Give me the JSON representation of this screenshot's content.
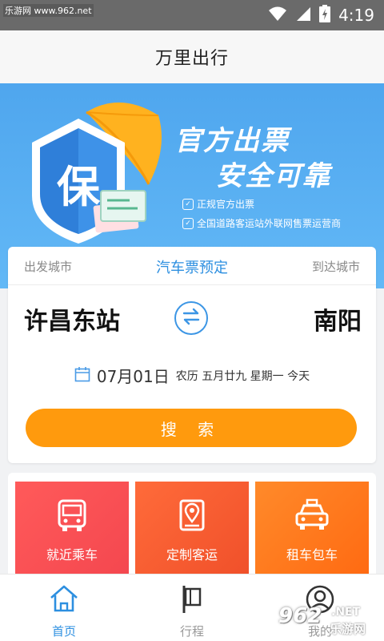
{
  "status_bar": {
    "watermark": "乐游网 www.962.net",
    "time": "4:19"
  },
  "header": {
    "title": "万里出行"
  },
  "banner": {
    "headline1": "官方出票",
    "headline2": "安全可靠",
    "shield_char": "保",
    "features": [
      "正规官方出票",
      "全国道路客运站外联网售票运营商"
    ]
  },
  "booking": {
    "depart_label": "出发城市",
    "title": "汽车票预定",
    "arrive_label": "到达城市",
    "from_city": "许昌东站",
    "to_city": "南阳",
    "date": "07月01日",
    "lunar": "农历 五月廿九  星期一  今天",
    "search_label": "搜 索"
  },
  "services": [
    {
      "label": "就近乘车",
      "icon": "bus-icon"
    },
    {
      "label": "定制客运",
      "icon": "map-location-icon"
    },
    {
      "label": "租车包车",
      "icon": "taxi-icon"
    }
  ],
  "nav": {
    "active_color": "#2d8fe0",
    "items": [
      {
        "label": "首页",
        "icon": "home-icon"
      },
      {
        "label": "行程",
        "icon": "flag-icon"
      },
      {
        "label": "我的",
        "icon": "user-icon"
      }
    ]
  },
  "watermark_bottom": {
    "number": "962",
    "net": ".NET",
    "text": "乐游网"
  }
}
